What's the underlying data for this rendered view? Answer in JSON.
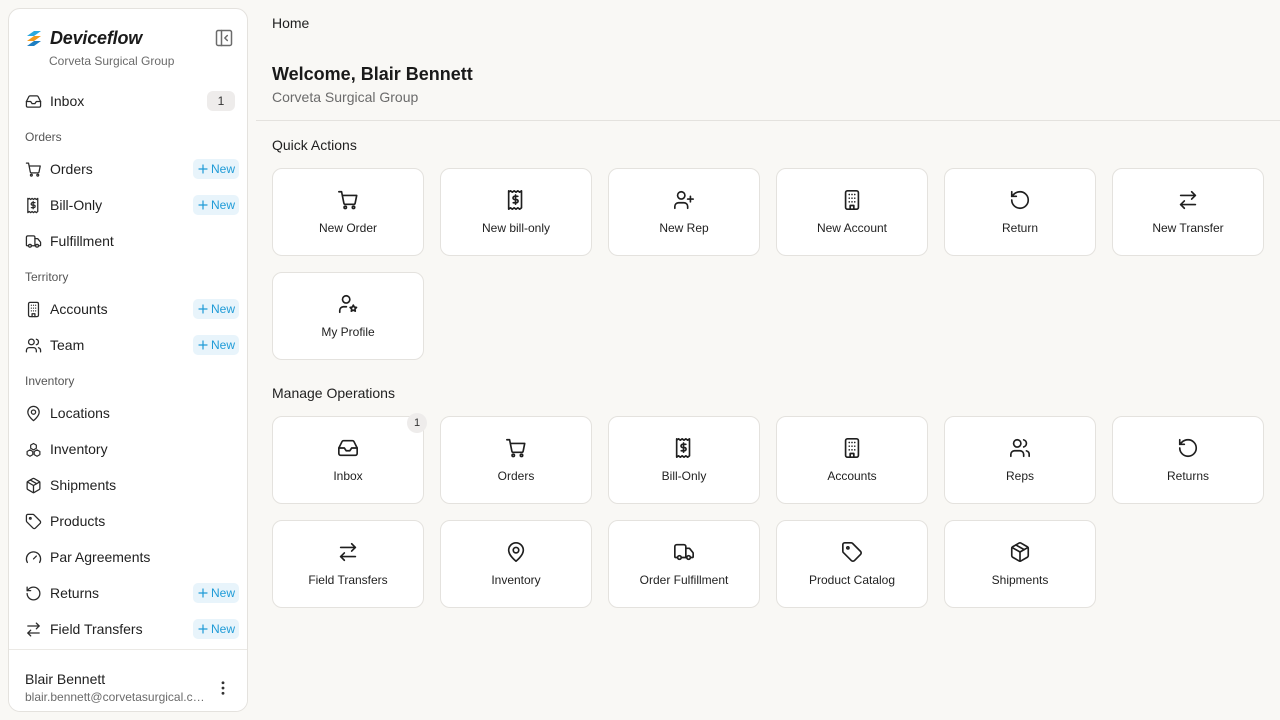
{
  "app": {
    "name": "Deviceflow",
    "org": "Corveta Surgical Group"
  },
  "sidebar": {
    "inbox": {
      "label": "Inbox",
      "count": "1"
    },
    "new_label": "New",
    "sections": {
      "orders": "Orders",
      "territory": "Territory",
      "inventory": "Inventory"
    },
    "items": {
      "orders": "Orders",
      "bill_only": "Bill-Only",
      "fulfillment": "Fulfillment",
      "accounts": "Accounts",
      "team": "Team",
      "locations": "Locations",
      "inventory": "Inventory",
      "shipments": "Shipments",
      "products": "Products",
      "par_agreements": "Par Agreements",
      "returns": "Returns",
      "field_transfers": "Field Transfers"
    },
    "user": {
      "name": "Blair Bennett",
      "email": "blair.bennett@corvetasurgical.com"
    }
  },
  "main": {
    "breadcrumb": "Home",
    "welcome": "Welcome, Blair Bennett",
    "subtitle": "Corveta Surgical Group",
    "quick_actions": {
      "heading": "Quick Actions",
      "new_order": "New Order",
      "new_bill_only": "New bill-only",
      "new_rep": "New Rep",
      "new_account": "New Account",
      "return": "Return",
      "new_transfer": "New Transfer",
      "my_profile": "My Profile"
    },
    "manage": {
      "heading": "Manage Operations",
      "inbox": "Inbox",
      "inbox_count": "1",
      "orders": "Orders",
      "bill_only": "Bill-Only",
      "accounts": "Accounts",
      "reps": "Reps",
      "returns": "Returns",
      "field_transfers": "Field Transfers",
      "inventory": "Inventory",
      "order_fulfillment": "Order Fulfillment",
      "product_catalog": "Product Catalog",
      "shipments": "Shipments"
    }
  },
  "colors": {
    "accent": "#1f9bd7",
    "background": "#f9f8f5"
  }
}
